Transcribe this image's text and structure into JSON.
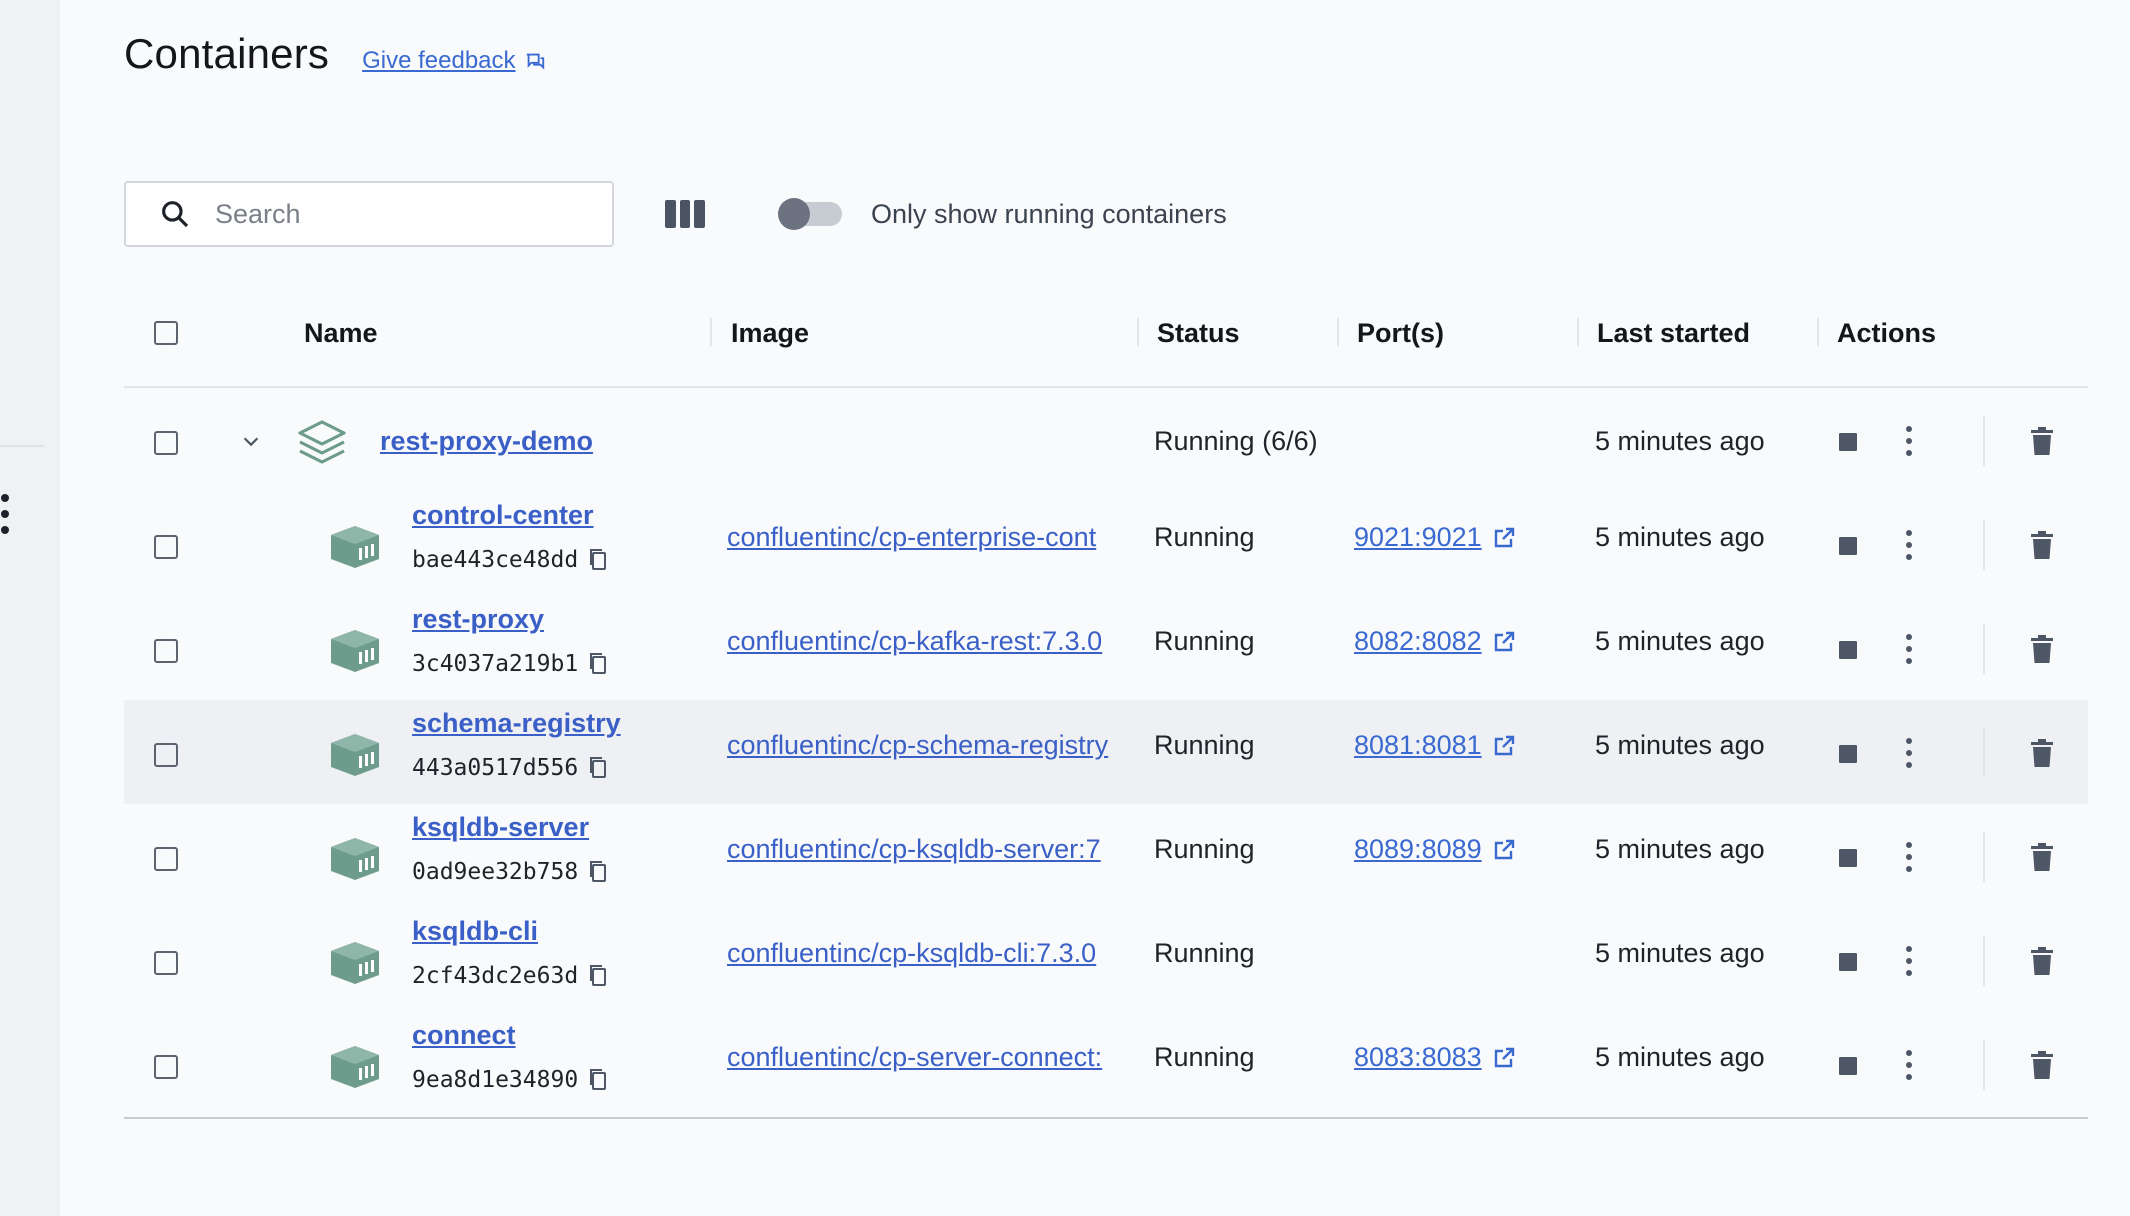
{
  "header": {
    "title": "Containers",
    "feedback_label": "Give feedback"
  },
  "toolbar": {
    "search_placeholder": "Search",
    "search_value": "",
    "running_toggle_label": "Only show running containers",
    "running_toggle_on": false
  },
  "table": {
    "columns": [
      "Name",
      "Image",
      "Status",
      "Port(s)",
      "Last started",
      "Actions"
    ],
    "group": {
      "name": "rest-proxy-demo",
      "status": "Running (6/6)",
      "last_started": "5 minutes ago",
      "expanded": true
    },
    "rows": [
      {
        "name": "control-center",
        "id": "bae443ce48dd",
        "image": "confluentinc/cp-enterprise-cont",
        "status": "Running",
        "port": "9021:9021",
        "last_started": "5 minutes ago"
      },
      {
        "name": "rest-proxy",
        "id": "3c4037a219b1",
        "image": "confluentinc/cp-kafka-rest:7.3.0",
        "status": "Running",
        "port": "8082:8082",
        "last_started": "5 minutes ago"
      },
      {
        "name": "schema-registry",
        "id": "443a0517d556",
        "image": "confluentinc/cp-schema-registry",
        "status": "Running",
        "port": "8081:8081",
        "last_started": "5 minutes ago"
      },
      {
        "name": "ksqldb-server",
        "id": "0ad9ee32b758",
        "image": "confluentinc/cp-ksqldb-server:7",
        "status": "Running",
        "port": "8089:8089",
        "last_started": "5 minutes ago"
      },
      {
        "name": "ksqldb-cli",
        "id": "2cf43dc2e63d",
        "image": "confluentinc/cp-ksqldb-cli:7.3.0",
        "status": "Running",
        "port": "",
        "last_started": "5 minutes ago"
      },
      {
        "name": "connect",
        "id": "9ea8d1e34890",
        "image": "confluentinc/cp-server-connect:",
        "status": "Running",
        "port": "8083:8083",
        "last_started": "5 minutes ago"
      }
    ]
  },
  "colors": {
    "link": "#3a5fc6",
    "container_icon": "#6e9c8c",
    "action_icon": "#4e5766"
  },
  "icons": {
    "search": "search-icon",
    "columns": "columns-icon",
    "feedback": "feedback-icon",
    "group": "stack-icon",
    "container": "container-icon",
    "copy": "copy-icon",
    "external": "external-link-icon",
    "stop": "stop-icon",
    "more": "more-vertical-icon",
    "delete": "trash-icon",
    "chevron": "chevron-down-icon"
  }
}
